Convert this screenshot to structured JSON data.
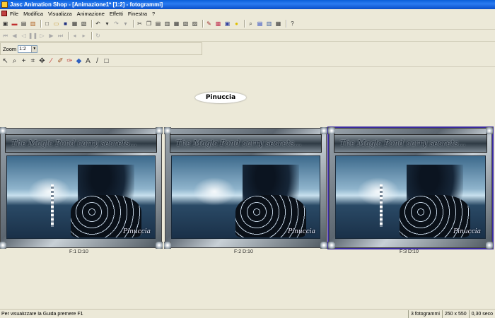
{
  "window": {
    "title": "Jasc Animation Shop - [Animazione1* [1:2] - fotogrammi]"
  },
  "menu": {
    "items": [
      "File",
      "Modifica",
      "Visualizza",
      "Animazione",
      "Effetti",
      "Finestra",
      "?"
    ]
  },
  "toolbar": {
    "main_icons": [
      "wizard-icon",
      "banner-icon",
      "optimize-icon",
      "open-icon",
      "new-icon",
      "open-file-icon",
      "save-icon",
      "save-as-icon",
      "print-icon",
      "undo-icon",
      "undo-dropdown-icon",
      "redo-icon",
      "redo-dropdown-icon",
      "cut-icon",
      "copy-icon",
      "paste-new-icon",
      "paste-before-icon",
      "paste-after-icon",
      "paste-selected-icon",
      "insert-frames-icon",
      "crop-icon",
      "resize-icon",
      "frame-properties-icon",
      "zoom-icon",
      "view-animation-icon",
      "effects-icon",
      "transition-icon",
      "help-icon"
    ],
    "playback_icons": [
      "first-frame-icon",
      "prev-frame-icon",
      "play-icon",
      "pause-icon",
      "next-frame-icon",
      "last-frame-icon",
      "prev-key-icon",
      "next-key-icon",
      "loop-icon"
    ],
    "tool_icons": [
      "select-arrow-icon",
      "zoom-tool-icon",
      "crosshair-icon",
      "crop-tool-icon",
      "move-icon",
      "dropper-icon",
      "brush-icon",
      "eraser-icon",
      "fill-icon",
      "text-tool-icon",
      "line-tool-icon",
      "rectangle-tool-icon"
    ]
  },
  "zoom": {
    "label": "Zoom",
    "value": "1:2"
  },
  "animation": {
    "name_label": "Pinuccia",
    "banner_text": "The Magic Pond carry secrets...",
    "signature": "Pinuccia",
    "frames": [
      {
        "label": "F:1  D:10",
        "selected": false
      },
      {
        "label": "F:2  D:10",
        "selected": false
      },
      {
        "label": "F:3  D:10",
        "selected": true
      }
    ]
  },
  "status": {
    "help": "Per visualizzare la Guida premere F1",
    "frames_count": "3 fotogrammi",
    "dimensions": "250 x 550",
    "duration": "0,30 seco"
  },
  "colors": {
    "title_bar": "#0a5fd9",
    "selection_outline": "#3a2aa0",
    "workspace": "#ece9d8"
  }
}
